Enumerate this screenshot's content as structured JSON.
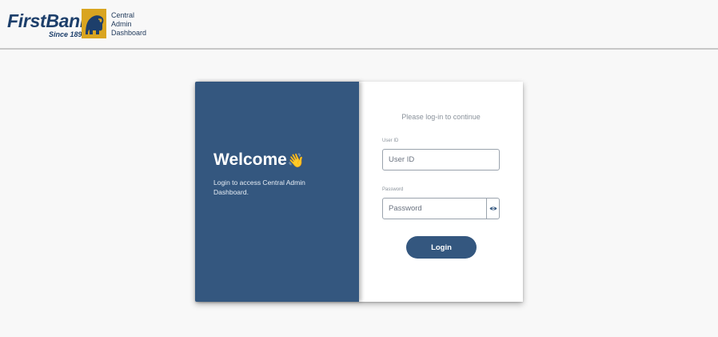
{
  "header": {
    "logo_text": "FirstBank",
    "logo_since": "Since 1894",
    "app_name_lines": [
      "Central",
      "Admin",
      "Dashboard"
    ]
  },
  "welcome_panel": {
    "title": "Welcome",
    "wave_emoji": "👋",
    "subtitle": "Login to access Central Admin Dashboard."
  },
  "login_form": {
    "prompt": "Please log-in to continue",
    "user_id": {
      "label": "User ID",
      "placeholder": "User ID",
      "value": ""
    },
    "password": {
      "label": "Password",
      "placeholder": "Password",
      "value": "",
      "toggle_icon": "eye-icon"
    },
    "submit_label": "Login"
  },
  "colors": {
    "brand_blue": "#34577f",
    "logo_gold": "#d9a520",
    "logo_navy": "#1d3f6b",
    "background": "#f8f8f8"
  }
}
